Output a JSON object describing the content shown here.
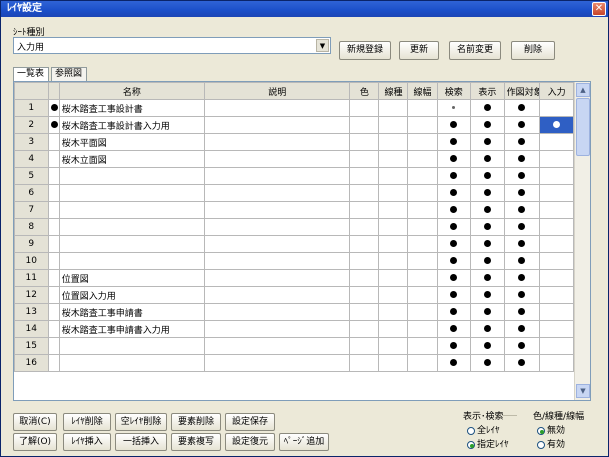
{
  "window": {
    "title": "ﾚｲﾔ設定",
    "close_glyph": "✕"
  },
  "sheet_group": {
    "label": "ｼｰﾄ種別",
    "value": "入力用"
  },
  "toolbar": {
    "new_label": "新規登録",
    "update_label": "更新",
    "rename_label": "名前変更",
    "delete_label": "削除"
  },
  "tabs": [
    {
      "label": "一覧表"
    },
    {
      "label": "参照図"
    }
  ],
  "grid": {
    "columns": [
      "",
      "",
      "名称",
      "説明",
      "色",
      "線種",
      "線幅",
      "検索",
      "表示",
      "作図対象",
      "入力"
    ],
    "rows": [
      {
        "num": "1",
        "flag": true,
        "name": "桜木踏査工事設計書",
        "search": "small",
        "show": true,
        "draw": true,
        "input": false
      },
      {
        "num": "2",
        "flag": true,
        "name": "桜木踏査工事設計書入力用",
        "search": "big",
        "show": true,
        "draw": true,
        "input": true
      },
      {
        "num": "3",
        "flag": false,
        "name": "桜木平面図",
        "search": "big",
        "show": true,
        "draw": true,
        "input": false
      },
      {
        "num": "4",
        "flag": false,
        "name": "桜木立面図",
        "search": "big",
        "show": true,
        "draw": true,
        "input": false
      },
      {
        "num": "5",
        "flag": false,
        "name": "",
        "search": "big",
        "show": true,
        "draw": true,
        "input": false
      },
      {
        "num": "6",
        "flag": false,
        "name": "",
        "search": "big",
        "show": true,
        "draw": true,
        "input": false
      },
      {
        "num": "7",
        "flag": false,
        "name": "",
        "search": "big",
        "show": true,
        "draw": true,
        "input": false
      },
      {
        "num": "8",
        "flag": false,
        "name": "",
        "search": "big",
        "show": true,
        "draw": true,
        "input": false
      },
      {
        "num": "9",
        "flag": false,
        "name": "",
        "search": "big",
        "show": true,
        "draw": true,
        "input": false
      },
      {
        "num": "10",
        "flag": false,
        "name": "",
        "search": "big",
        "show": true,
        "draw": true,
        "input": false
      },
      {
        "num": "11",
        "flag": false,
        "name": "位置図",
        "search": "big",
        "show": true,
        "draw": true,
        "input": false
      },
      {
        "num": "12",
        "flag": false,
        "name": "位置図入力用",
        "search": "big",
        "show": true,
        "draw": true,
        "input": false
      },
      {
        "num": "13",
        "flag": false,
        "name": "桜木踏査工事申請書",
        "search": "big",
        "show": true,
        "draw": true,
        "input": false
      },
      {
        "num": "14",
        "flag": false,
        "name": "桜木踏査工事申請書入力用",
        "search": "big",
        "show": true,
        "draw": true,
        "input": false
      },
      {
        "num": "15",
        "flag": false,
        "name": "",
        "search": "big",
        "show": true,
        "draw": true,
        "input": false
      },
      {
        "num": "16",
        "flag": false,
        "name": "",
        "search": "big",
        "show": true,
        "draw": true,
        "input": false
      }
    ]
  },
  "buttons": {
    "cancel": "取消(C)",
    "layer_delete": "ﾚｲﾔ削除",
    "empty_layer_delete": "空ﾚｲﾔ削除",
    "element_delete": "要素削除",
    "settings_save": "設定保存",
    "ok": "了解(O)",
    "layer_insert": "ﾚｲﾔ挿入",
    "bulk_insert": "一括挿入",
    "element_copy": "要素複写",
    "settings_restore": "設定復元",
    "page_add": "ﾍﾟｰｼﾞ追加"
  },
  "display_group": {
    "title": "表示･検索",
    "options": [
      "全ﾚｲﾔ",
      "指定ﾚｲﾔ"
    ],
    "selected": 1
  },
  "style_group": {
    "title": "色/線種/線幅",
    "options": [
      "無効",
      "有効"
    ],
    "selected": 0
  },
  "colors": {
    "selection": "#2f5fc4",
    "title_bar": "#1b4fc9"
  }
}
